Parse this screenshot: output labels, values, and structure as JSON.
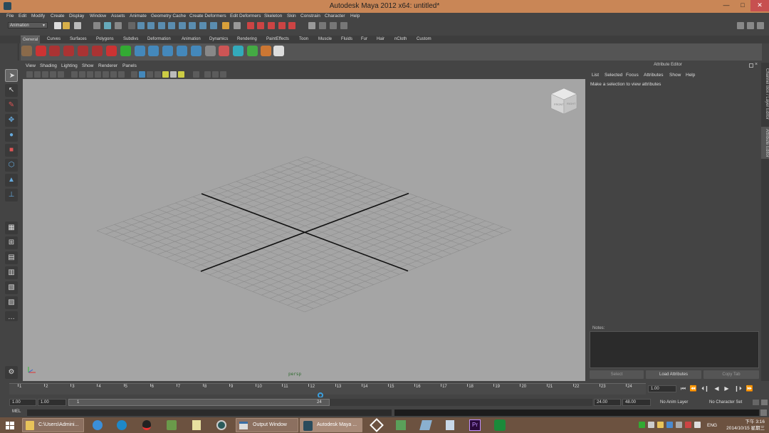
{
  "window": {
    "title": "Autodesk Maya 2012 x64: untitled*",
    "min": "—",
    "max": "□",
    "close": "✕"
  },
  "menu": [
    "File",
    "Edit",
    "Modify",
    "Create",
    "Display",
    "Window",
    "Assets",
    "Animate",
    "Geometry Cache",
    "Create Deformers",
    "Edit Deformers",
    "Skeleton",
    "Skin",
    "Constrain",
    "Character",
    "Help"
  ],
  "status_line": {
    "mode": "Animation"
  },
  "shelf_tabs": [
    "General",
    "Curves",
    "Surfaces",
    "Polygons",
    "Subdivs",
    "Deformation",
    "Animation",
    "Dynamics",
    "Rendering",
    "PaintEffects",
    "Toon",
    "Muscle",
    "Fluids",
    "Fur",
    "Hair",
    "nCloth",
    "Custom"
  ],
  "shelf_active": "General",
  "panel_menu": [
    "View",
    "Shading",
    "Lighting",
    "Show",
    "Renderer",
    "Panels"
  ],
  "viewport": {
    "camera_label": "persp",
    "view_cube_faces": [
      "FRONT",
      "RIGHT",
      "TOP"
    ]
  },
  "attribute_editor": {
    "title": "Attribute Editor",
    "menu": [
      "List",
      "Selected",
      "Focus",
      "Attributes",
      "Show",
      "Help"
    ],
    "message": "Make a selection to view attributes",
    "notes_label": "Notes:",
    "buttons": {
      "select": "Select",
      "load": "Load Attributes",
      "copy": "Copy Tab"
    }
  },
  "side_tabs": [
    "Channel Box / Layer Editor",
    "Attribute Editor"
  ],
  "time_slider": {
    "ticks": [
      "1",
      "2",
      "3",
      "4",
      "5",
      "6",
      "7",
      "8",
      "9",
      "10",
      "11",
      "12",
      "13",
      "14",
      "15",
      "16",
      "17",
      "18",
      "19",
      "20",
      "21",
      "22",
      "23",
      "24"
    ],
    "current_time": "1.00",
    "playback": [
      "⏮",
      "⏪",
      "⏴❙",
      "◀",
      "▶",
      "❙⏵",
      "⏩"
    ]
  },
  "range_slider": {
    "start_time": "1.00",
    "playback_start": "1.00",
    "range_start_label": "1",
    "range_end_label": "24",
    "playback_end": "24.00",
    "end_time": "48.00",
    "anim_layer": "No Anim Layer",
    "character_set": "No Character Set"
  },
  "mel_label": "MEL",
  "taskbar": {
    "explorer": "C:\\Users\\Admini...",
    "output": "Output Window",
    "maya": "Autodesk Maya ...",
    "lang": "ENG",
    "time": "下午 3:16",
    "date": "2014/10/15 星期三"
  }
}
